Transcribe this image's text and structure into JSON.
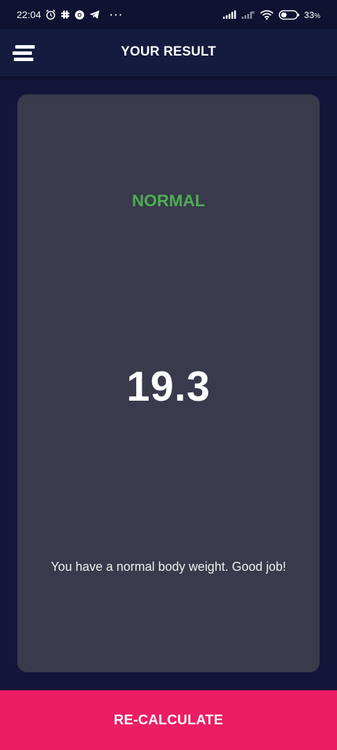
{
  "status_bar": {
    "time": "22:04",
    "more": "···",
    "battery": "33",
    "battery_unit": "%",
    "icons_left": [
      "alarm-icon",
      "slack-icon",
      "chrome-icon",
      "telegram-icon"
    ],
    "icons_right": [
      "signal-icon",
      "signal-weak-icon",
      "wifi-icon",
      "battery-icon"
    ]
  },
  "app_bar": {
    "title": "YOUR RESULT",
    "menu_icon": "menu-icon"
  },
  "result": {
    "status": "NORMAL",
    "bmi": "19.3",
    "interpretation": "You have a normal body weight. Good job!"
  },
  "actions": {
    "recalculate": "RE-CALCULATE"
  },
  "colors": {
    "background": "#131638",
    "status_bar": "#0f1230",
    "app_bar": "#151a3f",
    "card": "#393a4c",
    "status_normal": "#4caf50",
    "button": "#eb1d63",
    "text": "#ffffff"
  }
}
